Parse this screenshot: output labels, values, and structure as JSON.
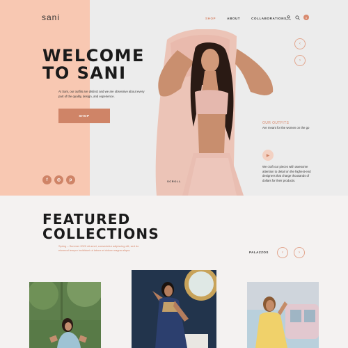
{
  "brand": {
    "logo": "sani"
  },
  "nav": {
    "items": [
      {
        "label": "SHOP",
        "active": true
      },
      {
        "label": "ABOUT",
        "active": false
      },
      {
        "label": "COLLABORATIONS",
        "active": false
      }
    ],
    "icons": [
      "user-icon",
      "search-icon",
      "cart-icon"
    ],
    "cart_count": "0"
  },
  "hero": {
    "headline_line1": "WELCOME",
    "headline_line2": "TO SANI",
    "description": "At Sani, our outfits are distinct and we are obsessive about every part of the quality, design, and experience.",
    "cta_label": "SHOP",
    "scroll_label": "SCROLL",
    "outfits_title": "OUR OUTFITS",
    "outfits_text": "Are meant for the women on the go",
    "craft_text": "We craft our pieces with awesome attention to detail on the highest-end designers that charge thousands of dollars for their products."
  },
  "socials": [
    {
      "name": "facebook-icon",
      "glyph": "f"
    },
    {
      "name": "instagram-icon",
      "glyph": "◎"
    },
    {
      "name": "pinterest-icon",
      "glyph": "p"
    }
  ],
  "featured": {
    "title_line1": "FEATURED",
    "title_line2": "COLLECTIONS",
    "description": "Spring – Summer 2020 sit amet, consectetur adipiscing elit, sed do eiusmod tempor incididunt ut labore et dolore magna aliqua.",
    "category": "PALAZZOS"
  },
  "colors": {
    "peach": "#f8c8b2",
    "accent": "#cf8467",
    "background": "#f4f2f1"
  }
}
